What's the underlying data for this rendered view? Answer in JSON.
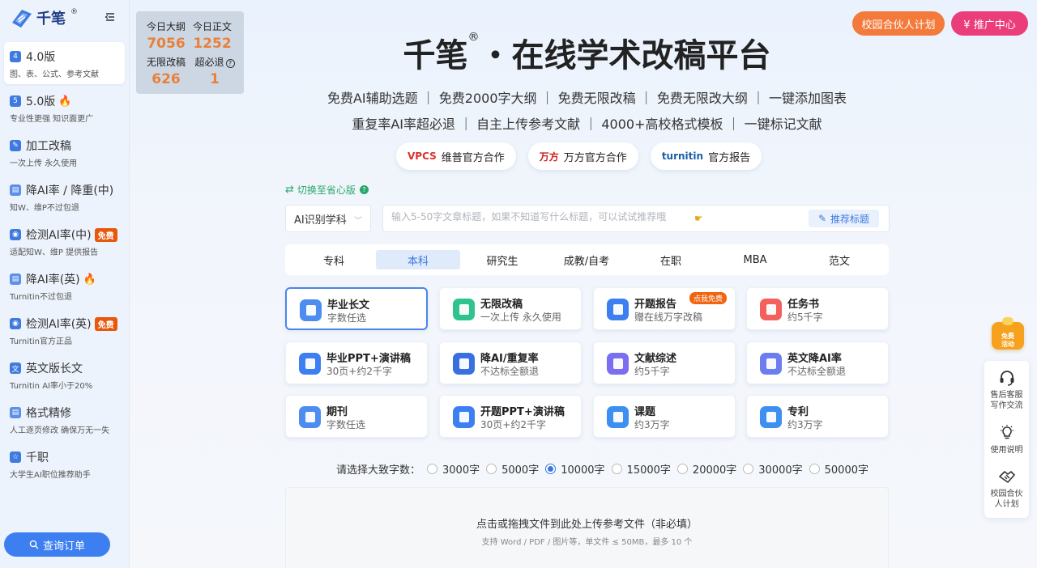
{
  "brand": {
    "name": "千笔",
    "reg": "®"
  },
  "sidebar": {
    "items": [
      {
        "label": "4.0版",
        "sub": "图、表、公式、参考文献",
        "icon": "v4-icon",
        "badge": "",
        "fire": false,
        "active": true
      },
      {
        "label": "5.0版",
        "sub": "专业性更强 知识面更广",
        "icon": "v5-icon",
        "badge": "",
        "fire": true,
        "active": false
      },
      {
        "label": "加工改稿",
        "sub": "一次上传 永久使用",
        "icon": "magic-wand-icon",
        "badge": "",
        "fire": false,
        "active": false
      },
      {
        "label": "降AI率 / 降重(中)",
        "sub": "知W、维P不过包退",
        "icon": "document-icon",
        "badge": "",
        "fire": false,
        "active": false
      },
      {
        "label": "检测AI率(中)",
        "sub": "适配知W、维P 提供报告",
        "icon": "detect-icon",
        "badge": "免费",
        "fire": false,
        "active": false
      },
      {
        "label": "降AI率(英)",
        "sub": "Turnitin不过包退",
        "icon": "document-icon",
        "badge": "",
        "fire": true,
        "active": false
      },
      {
        "label": "检测AI率(英)",
        "sub": "Turnitin官方正品",
        "icon": "detect-icon",
        "badge": "免费",
        "fire": false,
        "active": false
      },
      {
        "label": "英文版长文",
        "sub": "Turnitin AI率小于20%",
        "icon": "translate-icon",
        "badge": "",
        "fire": false,
        "active": false
      },
      {
        "label": "格式精修",
        "sub": "人工逐页修改 确保万无一失",
        "icon": "format-icon",
        "badge": "",
        "fire": false,
        "active": false
      },
      {
        "label": "千职",
        "sub": "大学生AI职位推荐助手",
        "icon": "job-icon",
        "badge": "",
        "fire": false,
        "active": false
      }
    ],
    "order_button": "查询订单"
  },
  "stats": {
    "today_outline_label": "今日大纲",
    "today_outline_value": "7056",
    "today_text_label": "今日正文",
    "today_text_value": "1252",
    "unlimited_label": "无限改稿",
    "unlimited_value": "626",
    "refund_label": "超必退",
    "refund_value": "1"
  },
  "top_buttons": {
    "campus": "校园合伙人计划",
    "promo": "¥ 推广中心"
  },
  "hero": {
    "title_main": "千笔",
    "title_reg": "®",
    "title_rest": "・在线学术改稿平台",
    "features_line1": "免费AI辅助选题 ｜ 免费2000字大纲 ｜ 免费无限改稿 ｜ 免费无限改大纲 ｜ 一键添加图表",
    "features_line2": "重复率AI率超必退 ｜ 自主上传参考文献 ｜ 4000+高校格式模板 ｜ 一键标记文献"
  },
  "partners": [
    {
      "mark": "VPCS",
      "label": "维普官方合作",
      "color": "#d9332b"
    },
    {
      "mark": "万方",
      "label": "万方官方合作",
      "color": "#c8201b"
    },
    {
      "mark": "turnitin",
      "label": "官方报告",
      "color": "#1a5fa8"
    }
  ],
  "switch_label": "切换至省心版",
  "discipline_select": "AI识别学科",
  "title_input": {
    "placeholder": "输入5-50字文章标题，如果不知道写什么标题，可以试试推荐哦",
    "value": ""
  },
  "recommend_button": "推荐标题",
  "degree_tabs": [
    {
      "label": "专科",
      "active": false
    },
    {
      "label": "本科",
      "active": true
    },
    {
      "label": "研究生",
      "active": false
    },
    {
      "label": "成教/自考",
      "active": false
    },
    {
      "label": "在职",
      "active": false
    },
    {
      "label": "MBA",
      "active": false
    },
    {
      "label": "范文",
      "active": false
    }
  ],
  "cards": [
    {
      "title": "毕业长文",
      "sub": "字数任选",
      "tag": "",
      "color": "#4d8df0",
      "active": true
    },
    {
      "title": "无限改稿",
      "sub": "一次上传 永久使用",
      "tag": "",
      "color": "#2fc48d",
      "active": false
    },
    {
      "title": "开题报告",
      "sub": "赠在线万字改稿",
      "tag": "点我免费",
      "color": "#3d7ff0",
      "active": false
    },
    {
      "title": "任务书",
      "sub": "约5千字",
      "tag": "",
      "color": "#f2615c",
      "active": false
    },
    {
      "title": "毕业PPT+演讲稿",
      "sub": "30页+约2千字",
      "tag": "",
      "color": "#3d7ff0",
      "active": false
    },
    {
      "title": "降AI/重复率",
      "sub": "不达标全额退",
      "tag": "",
      "color": "#3a6fe0",
      "active": false
    },
    {
      "title": "文献综述",
      "sub": "约5千字",
      "tag": "",
      "color": "#7b6ef0",
      "active": false
    },
    {
      "title": "英文降AI率",
      "sub": "不达标全额退",
      "tag": "",
      "color": "#6c7df0",
      "active": false
    },
    {
      "title": "期刊",
      "sub": "字数任选",
      "tag": "",
      "color": "#4d8df0",
      "active": false
    },
    {
      "title": "开题PPT+演讲稿",
      "sub": "30页+约2千字",
      "tag": "",
      "color": "#3d7ff0",
      "active": false
    },
    {
      "title": "课题",
      "sub": "约3万字",
      "tag": "",
      "color": "#3d8ff0",
      "active": false
    },
    {
      "title": "专利",
      "sub": "约3万字",
      "tag": "",
      "color": "#3d8ff0",
      "active": false
    }
  ],
  "word_count": {
    "label": "请选择大致字数：",
    "options": [
      "3000字",
      "5000字",
      "10000字",
      "15000字",
      "20000字",
      "30000字",
      "50000字"
    ],
    "selected": "10000字"
  },
  "upload": {
    "main": "点击或拖拽文件到此处上传参考文件（非必填）",
    "sub": "支持 Word / PDF / 图片等，单文件 ≤ 50MB，最多 10 个"
  },
  "float_promo": {
    "line1": "免费",
    "line2": "活动"
  },
  "side_panel": [
    {
      "line1": "售后客服",
      "line2": "写作交流",
      "icon": "headset-icon"
    },
    {
      "line1": "使用说明",
      "line2": "",
      "icon": "lightbulb-icon"
    },
    {
      "line1": "校园合伙",
      "line2": "人计划",
      "icon": "handshake-icon"
    }
  ]
}
